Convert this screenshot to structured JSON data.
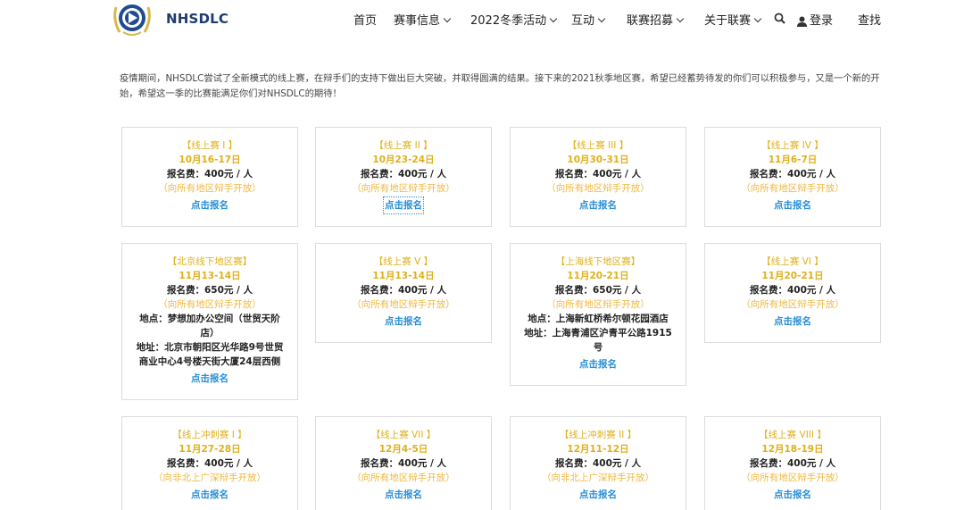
{
  "brand": {
    "name": "NHSDLC"
  },
  "nav": {
    "home": "首页",
    "events": "赛事信息",
    "winter": "2022冬季活动",
    "interact": "互动",
    "recruit": "联赛招募",
    "about": "关于联赛",
    "login": "登录",
    "search": "查找"
  },
  "intro": "疫情期间，NHSDLC尝试了全新模式的线上赛，在辩手们的支持下做出巨大突破，并取得圆满的结果。接下来的2021秋季地区赛，希望已经蓄势待发的你们可以积极参与，又是一个新的开始，希望这一季的比赛能满足你们对NHSDLC的期待！",
  "cards": [
    {
      "title": "【线上赛 I 】",
      "date": "10月16-17日",
      "fee": "报名费：400元 / 人",
      "open": "（向所有地区辩手开放）",
      "link": "点击报名"
    },
    {
      "title": "【线上赛 II 】",
      "date": "10月23-24日",
      "fee": "报名费：400元 / 人",
      "open": "（向所有地区辩手开放）",
      "link": "点击报名"
    },
    {
      "title": "【线上赛 III 】",
      "date": "10月30-31日",
      "fee": "报名费：400元 / 人",
      "open": "（向所有地区辩手开放）",
      "link": "点击报名"
    },
    {
      "title": "【线上赛 IV 】",
      "date": "11月6-7日",
      "fee": "报名费：400元 / 人",
      "open": "（向所有地区辩手开放）",
      "link": "点击报名"
    },
    {
      "title": "【北京线下地区赛】",
      "date": "11月13-14日",
      "fee": "报名费：650元 / 人",
      "open": "（向所有地区辩手开放）",
      "venue": "地点：梦想加办公空间（世贸天阶店）",
      "address": "地址：北京市朝阳区光华路9号世贸商业中心4号楼天街大厦24层西侧",
      "link": "点击报名"
    },
    {
      "title": "【线上赛 V 】",
      "date": "11月13-14日",
      "fee": "报名费：400元 / 人",
      "open": "（向所有地区辩手开放）",
      "link": "点击报名"
    },
    {
      "title": "【上海线下地区赛】",
      "date": "11月20-21日",
      "fee": "报名费：650元 / 人",
      "open": "（向所有地区辩手开放）",
      "venue": "地点：上海新虹桥希尔顿花园酒店",
      "address": "地址：上海青浦区沪青平公路1915号",
      "link": "点击报名"
    },
    {
      "title": "【线上赛 VI 】",
      "date": "11月20-21日",
      "fee": "报名费：400元 / 人",
      "open": "（向所有地区辩手开放）",
      "link": "点击报名"
    },
    {
      "title": "【线上冲刺赛 I 】",
      "date": "11月27-28日",
      "fee": "报名费：400元 / 人",
      "open": "（向非北上广深辩手开放）",
      "link": "点击报名"
    },
    {
      "title": "【线上赛 VII 】",
      "date": "12月4-5日",
      "fee": "报名费：400元 / 人",
      "open": "（向所有地区辩手开放）",
      "link": "点击报名"
    },
    {
      "title": "【线上冲刺赛 II 】",
      "date": "12月11-12日",
      "fee": "报名费：400元 / 人",
      "open": "（向非北上广深辩手开放）",
      "link": "点击报名"
    },
    {
      "title": "【线上赛 VIII 】",
      "date": "12月18-19日",
      "fee": "报名费：400元 / 人",
      "open": "（向所有地区辩手开放）",
      "link": "点击报名"
    }
  ]
}
